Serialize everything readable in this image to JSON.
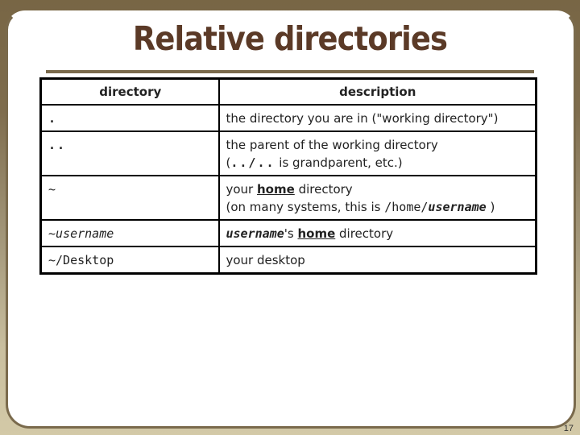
{
  "slide": {
    "title": "Relative directories",
    "page_number": "17"
  },
  "table": {
    "headers": [
      "directory",
      "description"
    ],
    "rows": [
      {
        "directory": ".",
        "description": "the directory you are in (\"working directory\")"
      },
      {
        "directory": "..",
        "description_line1": "the parent of the working directory",
        "description_line2_code": "../..",
        "description_line2_rest": " is grandparent, etc.)",
        "description_line2_open": "("
      },
      {
        "directory": "~",
        "description_pre": "your ",
        "description_emph": "home",
        "description_post": " directory",
        "description_line2_pre": "(on many systems, this is ",
        "description_line2_code": "/home/",
        "description_line2_code_it": "username",
        "description_line2_post": " )"
      },
      {
        "directory_prefix": "~",
        "directory_it": "username",
        "description_code_it": "username",
        "description_mid": "'s ",
        "description_emph": "home",
        "description_post": " directory"
      },
      {
        "directory": "~/Desktop",
        "description": "your desktop"
      }
    ]
  },
  "colors": {
    "title": "#5b3a27",
    "frame": "#7a6a4c",
    "background_top": "#786645",
    "background_bottom": "#d3c9a7"
  }
}
